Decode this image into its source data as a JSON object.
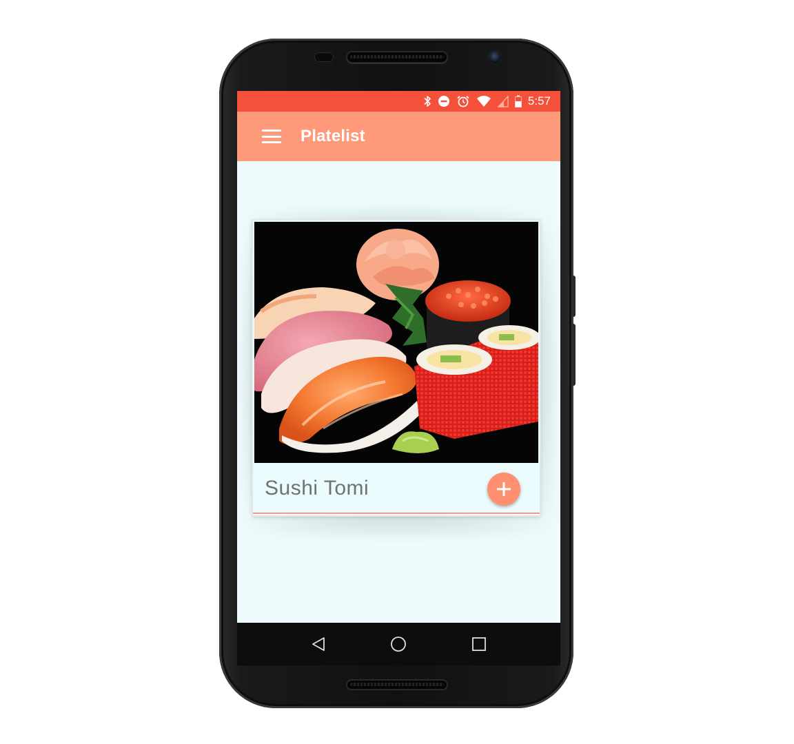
{
  "status_bar": {
    "time": "5:57",
    "icons": [
      "bluetooth-icon",
      "do-not-disturb-icon",
      "alarm-icon",
      "wifi-icon",
      "signal-icon",
      "battery-icon"
    ]
  },
  "app_bar": {
    "title": "Platelist",
    "menu_icon": "menu-icon"
  },
  "card": {
    "image_subject": "sushi plate",
    "plate_name": "Sushi Tomi",
    "add_icon": "plus-icon"
  },
  "nav_bar": {
    "icons": [
      "back-icon",
      "home-icon",
      "recents-icon"
    ]
  },
  "colors": {
    "status_bar": "#f4503a",
    "app_bar": "#fe997a",
    "screen_background": "#eefcfd",
    "fab": "#fe8f71",
    "plate_name_text": "#727272"
  }
}
